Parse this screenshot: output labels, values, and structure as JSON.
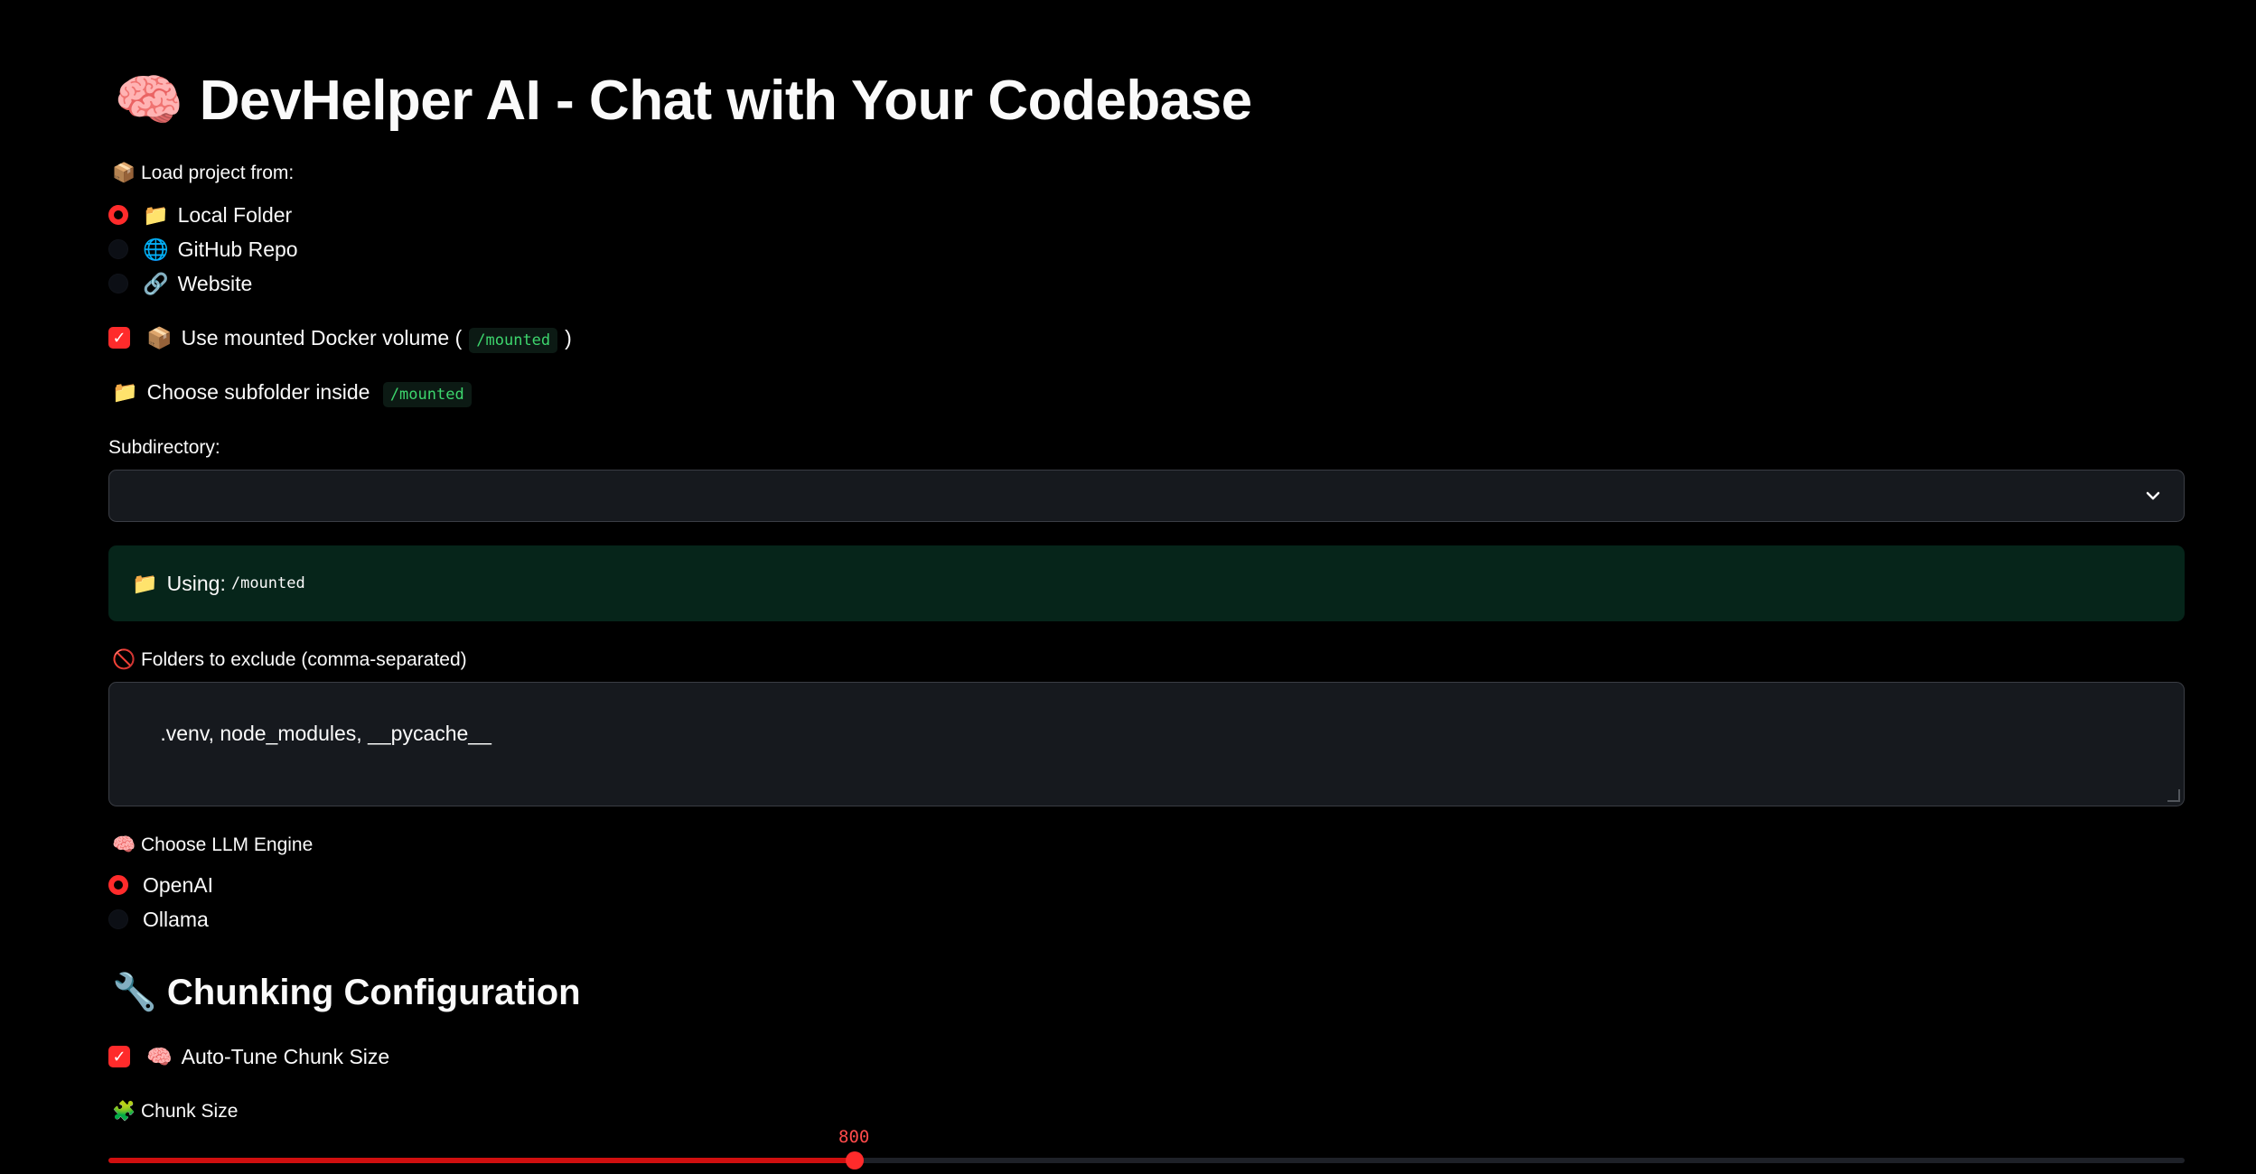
{
  "title": {
    "emoji": "🧠",
    "text": "DevHelper AI - Chat with Your Codebase"
  },
  "load_source": {
    "label": "📦 Load project from:",
    "options": [
      {
        "icon": "📁",
        "label": "Local Folder",
        "selected": true
      },
      {
        "icon": "🌐",
        "label": "GitHub Repo",
        "selected": false
      },
      {
        "icon": "🔗",
        "label": "Website",
        "selected": false
      }
    ]
  },
  "docker_volume": {
    "checked": true,
    "icon": "📦",
    "label_pre": "Use mounted Docker volume (",
    "code": "/mounted",
    "label_post": ")"
  },
  "subfolder_heading": {
    "icon": "📁",
    "text": "Choose subfolder inside",
    "code": "/mounted"
  },
  "subdirectory": {
    "label": "Subdirectory:",
    "value": ""
  },
  "using_alert": {
    "icon": "📁",
    "text": "Using:",
    "code": "/mounted"
  },
  "exclude": {
    "label": "🚫 Folders to exclude (comma-separated)",
    "value": ".venv, node_modules, __pycache__"
  },
  "llm_engine": {
    "label": "🧠 Choose LLM Engine",
    "options": [
      {
        "label": "OpenAI",
        "selected": true
      },
      {
        "label": "Ollama",
        "selected": false
      }
    ]
  },
  "chunking": {
    "heading": "🔧 Chunking Configuration",
    "auto_tune": {
      "checked": true,
      "icon": "🧠",
      "label": "Auto-Tune Chunk Size"
    },
    "chunk_size": {
      "label": "🧩 Chunk Size",
      "value": "800",
      "fraction": 0.3594
    }
  },
  "colors": {
    "accent": "#ff2b2b",
    "background": "#000000",
    "success_bg": "#06251a",
    "code_text": "#3dd56d"
  }
}
